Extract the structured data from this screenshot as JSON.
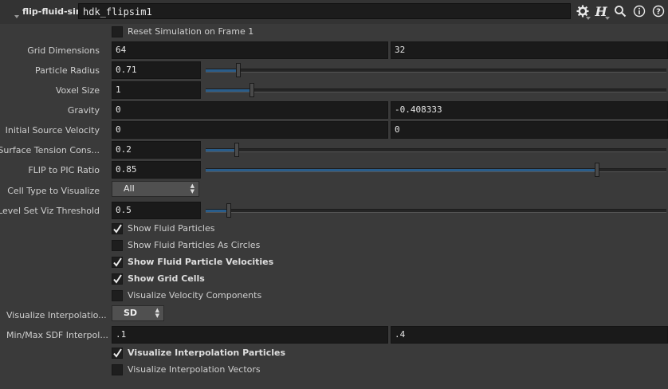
{
  "header": {
    "node_type": "flip-fluid-sim",
    "node_name": "hdk_flipsim1"
  },
  "params": {
    "reset_sim": {
      "label": "Reset Simulation on Frame 1",
      "checked": false
    },
    "grid_dims": {
      "label": "Grid Dimensions",
      "x": "64",
      "y": "32"
    },
    "particle_radius": {
      "label": "Particle Radius",
      "value": "0.71",
      "fraction": 0.071
    },
    "voxel_size": {
      "label": "Voxel Size",
      "value": "1",
      "fraction": 0.1
    },
    "gravity": {
      "label": "Gravity",
      "x": "0",
      "y": "-0.408333"
    },
    "init_vel": {
      "label": "Initial Source Velocity",
      "x": "0",
      "y": "0"
    },
    "surface_tension": {
      "label": "Surface Tension Cons...",
      "value": "0.2",
      "fraction": 0.067
    },
    "flip_pic": {
      "label": "FLIP to PIC Ratio",
      "value": "0.85",
      "fraction": 0.85
    },
    "cell_type": {
      "label": "Cell Type to Visualize",
      "value": "All"
    },
    "levelset_thresh": {
      "label": "Level Set Viz Threshold",
      "value": "0.5",
      "fraction": 0.05
    },
    "show_particles": {
      "label": "Show Fluid Particles",
      "checked": true,
      "bold": false
    },
    "show_circles": {
      "label": "Show Fluid Particles As Circles",
      "checked": false,
      "bold": false
    },
    "show_velocities": {
      "label": "Show Fluid Particle Velocities",
      "checked": true,
      "bold": true
    },
    "show_grid": {
      "label": "Show Grid Cells",
      "checked": true,
      "bold": true
    },
    "vis_vel_components": {
      "label": "Visualize Velocity Components",
      "checked": false,
      "bold": false
    },
    "vis_interp": {
      "label": "Visualize Interpolatio...",
      "value": "SD"
    },
    "minmax_sdf": {
      "label": "Min/Max SDF Interpol...",
      "min": ".1",
      "max": ".4"
    },
    "vis_interp_particles": {
      "label": "Visualize Interpolation Particles",
      "checked": true,
      "bold": true
    },
    "vis_interp_vectors": {
      "label": "Visualize Interpolation Vectors",
      "checked": false,
      "bold": false
    }
  },
  "colors": {
    "accent": "#2a5d8a",
    "bg": "#3a3a3a",
    "field": "#1a1a1a"
  }
}
